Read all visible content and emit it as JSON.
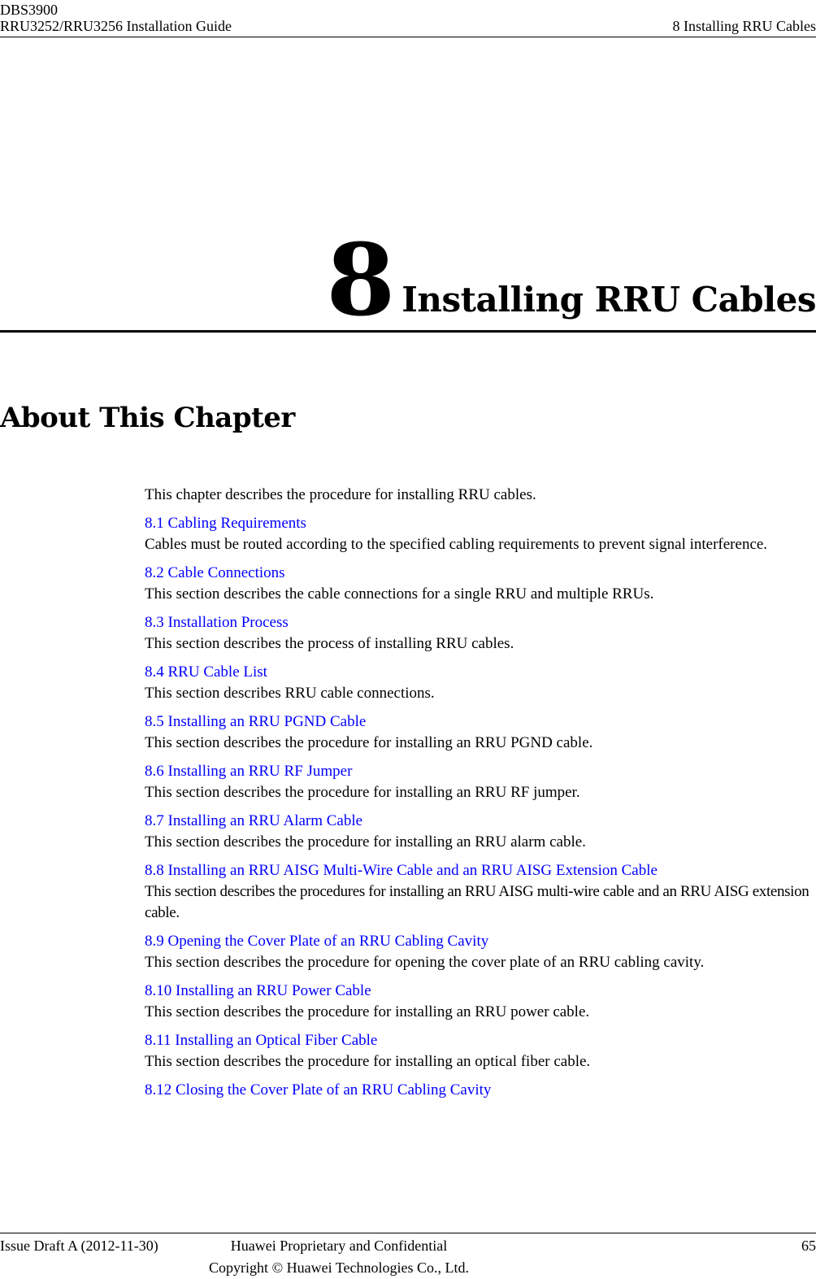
{
  "header": {
    "product": "DBS3900",
    "guide": "RRU3252/RRU3256 Installation Guide",
    "chapter_ref": "8 Installing RRU Cables"
  },
  "chapter": {
    "number": "8",
    "title": "Installing RRU Cables"
  },
  "about": {
    "heading": "About This Chapter",
    "intro": "This chapter describes the procedure for installing RRU cables."
  },
  "entries": [
    {
      "link": "8.1 Cabling Requirements",
      "desc": "Cables must be routed according to the specified cabling requirements to prevent signal interference."
    },
    {
      "link": "8.2 Cable Connections",
      "desc": "This section describes the cable connections for a single RRU and multiple RRUs."
    },
    {
      "link": "8.3 Installation Process",
      "desc": "This section describes the process of installing RRU cables."
    },
    {
      "link": "8.4 RRU Cable List",
      "desc": "This section describes RRU cable connections."
    },
    {
      "link": "8.5 Installing an RRU PGND Cable",
      "desc": "This section describes the procedure for installing an RRU PGND cable."
    },
    {
      "link": "8.6 Installing an RRU RF Jumper",
      "desc": "This section describes the procedure for installing an RRU RF jumper."
    },
    {
      "link": "8.7 Installing an RRU Alarm Cable",
      "desc": "This section describes the procedure for installing an RRU alarm cable."
    },
    {
      "link": "8.8 Installing an RRU AISG Multi-Wire Cable and an RRU AISG Extension Cable",
      "desc": "This section describes the procedures for installing an RRU AISG multi-wire cable and an RRU AISG extension cable."
    },
    {
      "link": "8.9 Opening the Cover Plate of an RRU Cabling Cavity",
      "desc": "This section describes the procedure for opening the cover plate of an RRU cabling cavity."
    },
    {
      "link": "8.10 Installing an RRU Power Cable",
      "desc": "This section describes the procedure for installing an RRU power cable."
    },
    {
      "link": "8.11 Installing an Optical Fiber Cable",
      "desc": "This section describes the procedure for installing an optical fiber cable."
    },
    {
      "link": "8.12 Closing the Cover Plate of an RRU Cabling Cavity",
      "desc": ""
    }
  ],
  "footer": {
    "issue": "Issue Draft A (2012-11-30)",
    "proprietary": "Huawei Proprietary and Confidential",
    "copyright": "Copyright © Huawei Technologies Co., Ltd.",
    "page": "65"
  },
  "colors": {
    "link": "#0000ff",
    "text": "#000000"
  }
}
